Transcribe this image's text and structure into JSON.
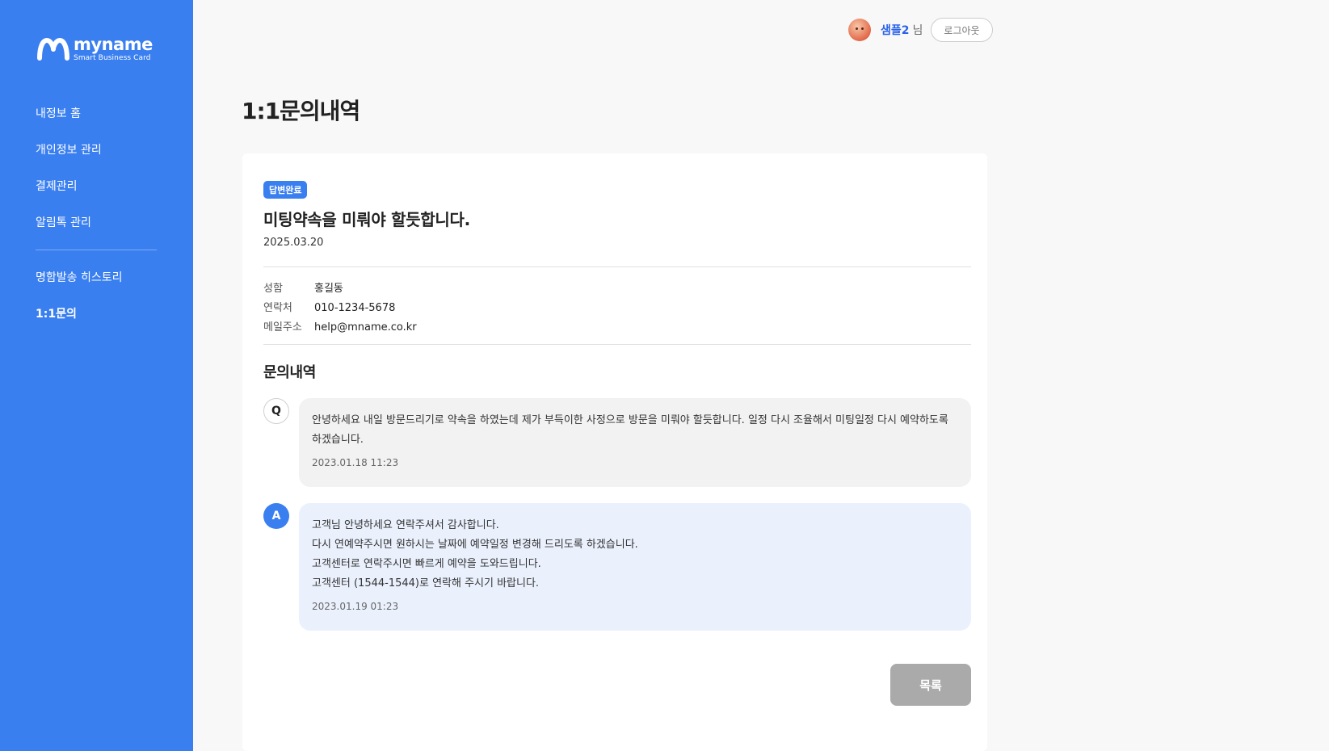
{
  "brand": {
    "name": "myname",
    "tagline": "Smart Business Card"
  },
  "sidebar": {
    "items": [
      {
        "label": "내정보 홈"
      },
      {
        "label": "개인정보 관리"
      },
      {
        "label": "결제관리"
      },
      {
        "label": "알림톡 관리"
      },
      {
        "label": "명함발송 히스토리"
      },
      {
        "label": "1:1문의"
      }
    ]
  },
  "header": {
    "username": "샘플2",
    "suffix": "님",
    "logout_label": "로그아웃"
  },
  "page": {
    "title": "1:1문의내역"
  },
  "inquiry": {
    "status": "답변완료",
    "subject": "미팅약속을 미뤄야 할듯합니다.",
    "date": "2025.03.20",
    "info": [
      {
        "label": "성함",
        "value": "홍길동"
      },
      {
        "label": "연락처",
        "value": "010-1234-5678"
      },
      {
        "label": "메일주소",
        "value": "help@mname.co.kr"
      }
    ],
    "section_title": "문의내역",
    "question": {
      "marker": "Q",
      "lines": [
        "안녕하세요 내일 방문드리기로 약속을 하였는데 제가 부득이한 사정으로 방문을 미뤄야 할듯합니다. 일정 다시 조율해서 미팅일정 다시 예약하도록 하겠습니다."
      ],
      "time": "2023.01.18 11:23"
    },
    "answer": {
      "marker": "A",
      "lines": [
        "고객님 안녕하세요 연락주셔서 감사합니다.",
        "다시 연예약주시면 원하시는 날짜에 예약일정 변경해 드리도록 하겠습니다.",
        "고객센터로 연락주시면 빠르게 예약을 도와드립니다.",
        "고객센터 (1544-1544)로 연락해 주시기 바랍니다."
      ],
      "time": "2023.01.19 01:23"
    },
    "list_button_label": "목록"
  },
  "colors": {
    "accent": "#3a7ff0",
    "username": "#2a62e8",
    "button_disabled": "#aaaaaa"
  }
}
